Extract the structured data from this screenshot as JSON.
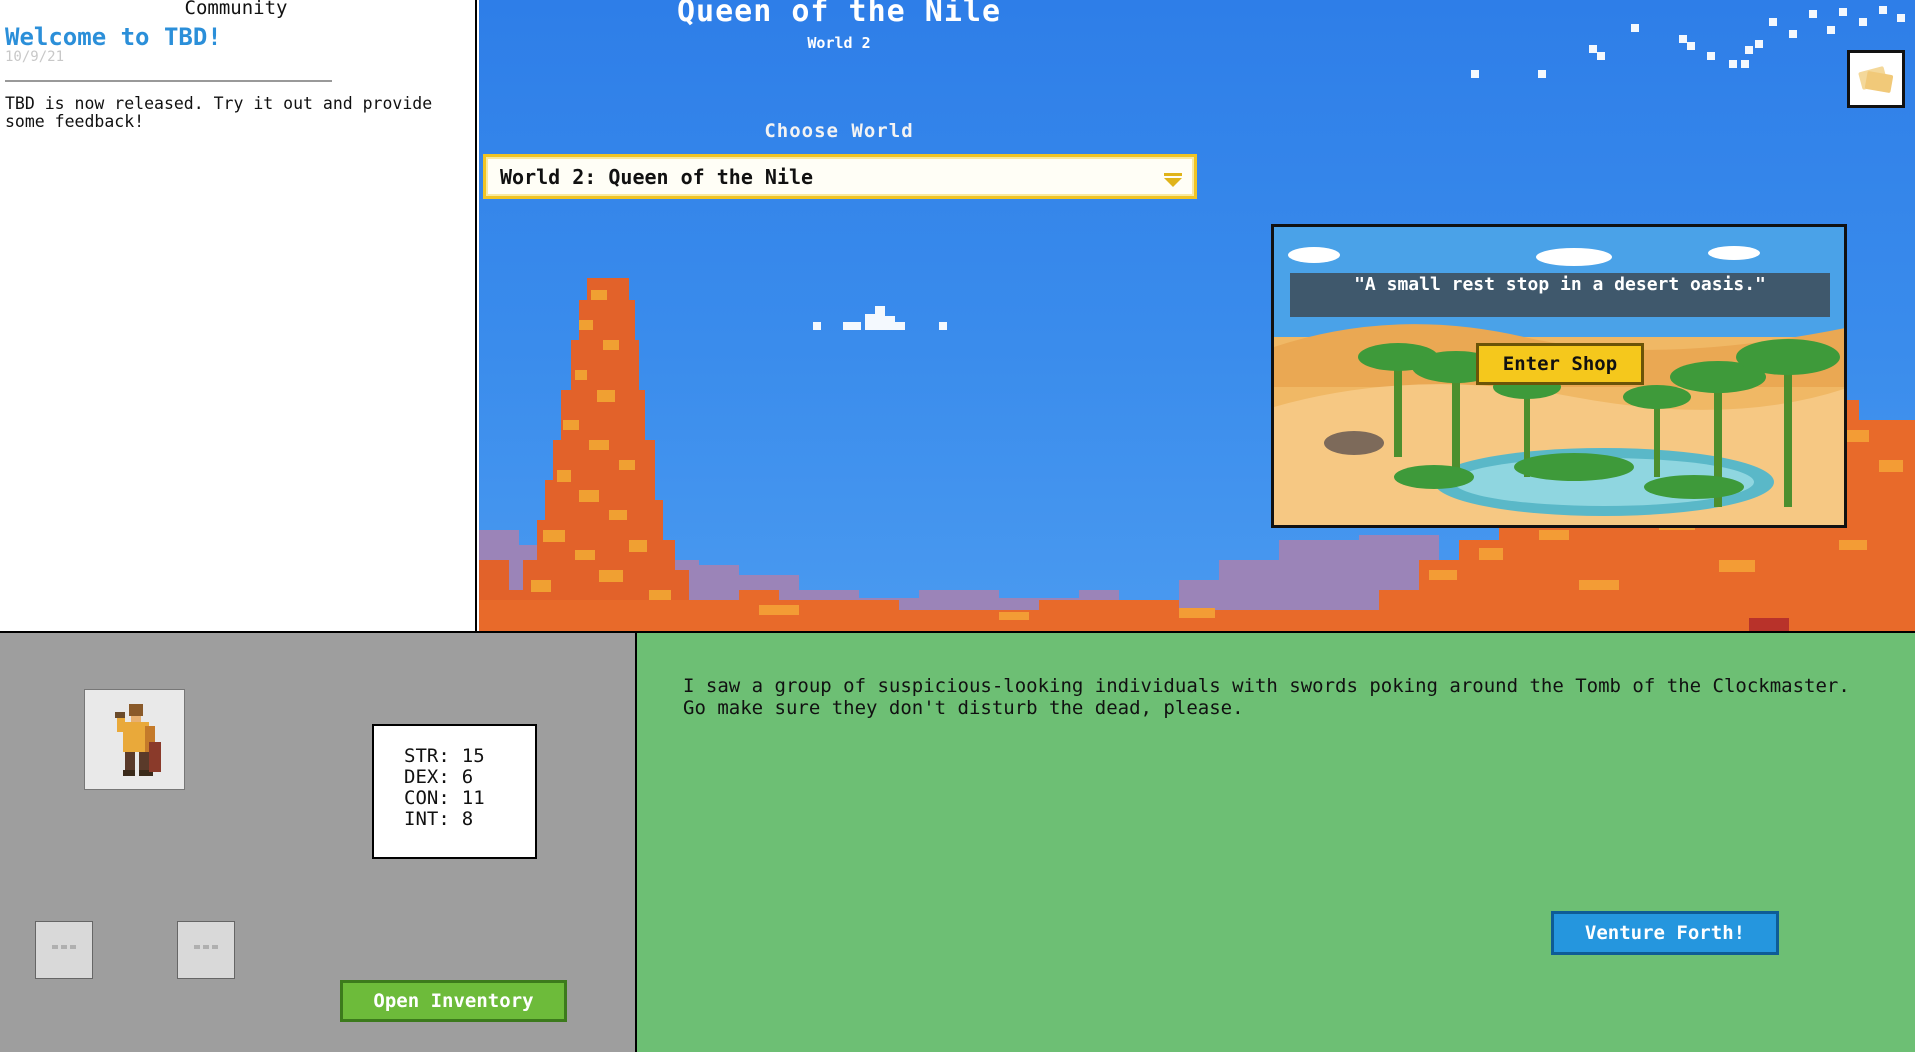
{
  "community": {
    "header": "Community",
    "post": {
      "title": "Welcome to TBD!",
      "date": "10/9/21",
      "body": "TBD is now released. Try it out and provide some feedback!"
    }
  },
  "world": {
    "title": "Queen of the Nile",
    "subtitle": "World 2",
    "choose_label": "Choose World",
    "select": {
      "selected": "World 2: Queen of the Nile",
      "arrow_icon": "chevron-down-icon",
      "accent_color": "#f0c424"
    },
    "shop": {
      "quote": "\"A small rest stop in a desert oasis.\"",
      "button_label": "Enter Shop"
    },
    "corner_card_icon": "cards-icon"
  },
  "character": {
    "portrait_icon": "adventurer-portrait",
    "stats": [
      {
        "label": "STR:",
        "value": "15"
      },
      {
        "label": "DEX:",
        "value": "6"
      },
      {
        "label": "CON:",
        "value": "11"
      },
      {
        "label": "INT:",
        "value": "8"
      }
    ],
    "equipment_slots": [
      "slot-1",
      "slot-2"
    ],
    "inventory_button": "Open Inventory"
  },
  "quest": {
    "description": "I saw a group of suspicious-looking individuals with swords poking around the Tomb of the Clockmaster. Go make sure they don't disturb the dead, please.",
    "venture_button": "Venture Forth!"
  },
  "colors": {
    "sky": "#3a8cec",
    "quest_bg": "#6dbf74",
    "character_bg": "#9e9e9e",
    "venture": "#2596de",
    "inventory": "#6dbb3a",
    "link_blue": "#2b8fd9"
  }
}
